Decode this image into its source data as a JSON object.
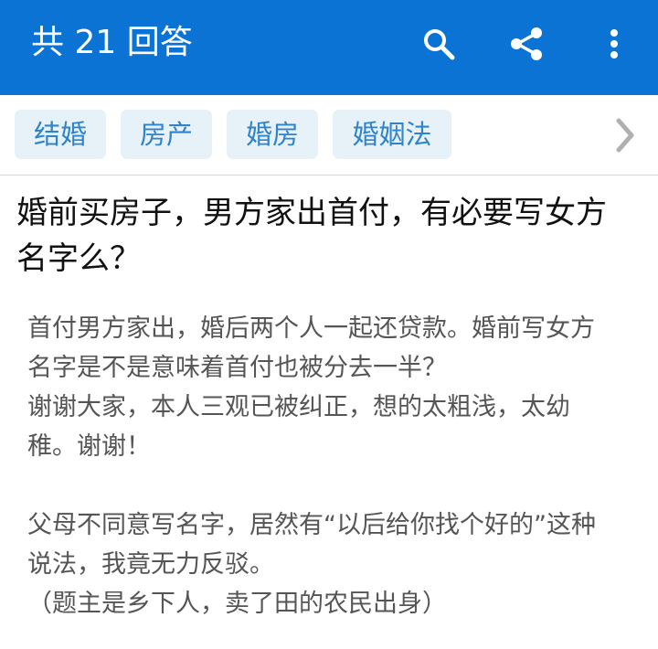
{
  "appbar": {
    "title": "共 21 回答",
    "background": "#0a73d3",
    "icons": [
      "search-icon",
      "share-icon",
      "more-vert-icon"
    ]
  },
  "tags": {
    "items": [
      {
        "label": "结婚"
      },
      {
        "label": "房产"
      },
      {
        "label": "婚房"
      },
      {
        "label": "婚姻法"
      }
    ],
    "scroll_icon": "chevron-right-icon",
    "tag_background": "#e6f1f8",
    "tag_text_color": "#2e83c9"
  },
  "question": {
    "title_line1": "婚前买房子，男方家出首付，有必要写女方",
    "title_line2": "名字么？",
    "body": [
      "首付男方家出，婚后两个人一起还贷款。婚前写女方",
      "名字是不是意味着首付也被分去一半？",
      "谢谢大家，本人三观已被纠正，想的太粗浅，太幼",
      "稚。谢谢！",
      "",
      "父母不同意写名字，居然有“以后给你找个好的”这种",
      "说法，我竟无力反驳。",
      "（题主是乡下人，卖了田的农民出身）"
    ]
  }
}
